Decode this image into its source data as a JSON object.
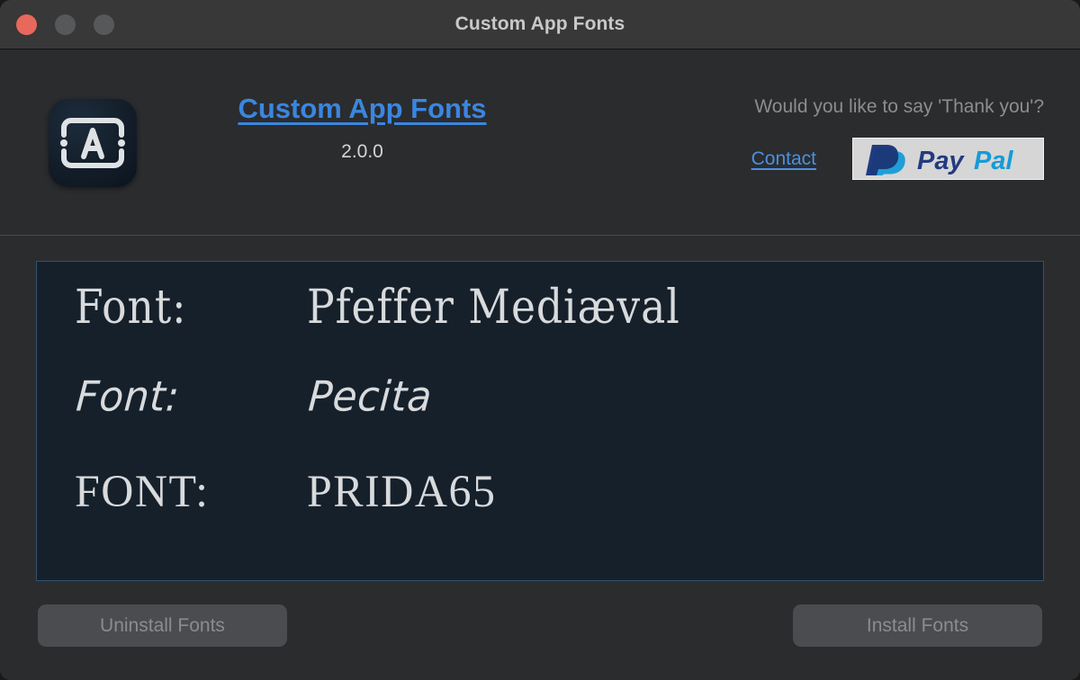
{
  "window": {
    "title": "Custom App Fonts",
    "traffic_lights": [
      {
        "name": "close",
        "color": "#e8685c"
      },
      {
        "name": "minimize",
        "color": "#57585a"
      },
      {
        "name": "zoom",
        "color": "#57585a"
      }
    ]
  },
  "header": {
    "app_icon_label": "A",
    "app_name_link": "Custom App Fonts",
    "app_version": "2.0.0",
    "thanks_prompt": "Would you like to say 'Thank you'?",
    "contact_label": "Contact",
    "paypal_label": "PayPal",
    "paypal_pay": "Pay",
    "paypal_pal": "Pal",
    "link_color": "#3a86e0"
  },
  "preview": {
    "panel_background": "#16202b",
    "panel_border": "#33526b",
    "rows": [
      {
        "label": "Font:",
        "name": "Pfeffer Mediæval"
      },
      {
        "label": "Font:",
        "name": "Pecita"
      },
      {
        "label": "FONT:",
        "name": "PRIDA65"
      }
    ]
  },
  "footer": {
    "uninstall_label": "Uninstall Fonts",
    "install_label": "Install Fonts"
  }
}
